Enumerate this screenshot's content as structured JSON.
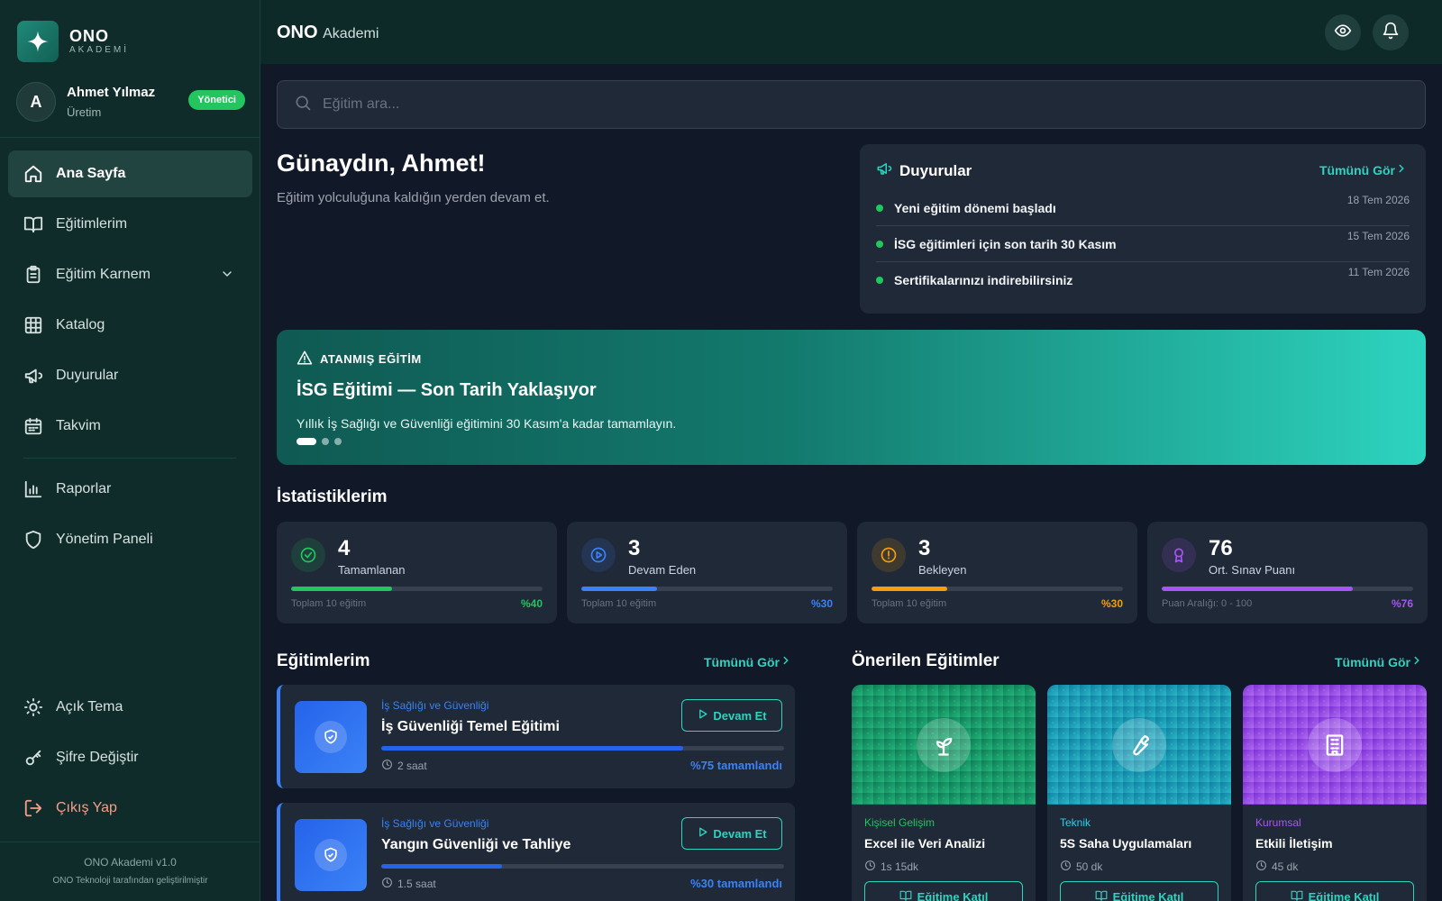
{
  "app": {
    "name": "ONO",
    "sub": "AKADEMİ",
    "top_title_bold": "ONO",
    "top_title_rest": "Akademi"
  },
  "user": {
    "initial": "A",
    "name": "Ahmet Yılmaz",
    "department": "Üretim",
    "role_badge": "Yönetici"
  },
  "nav": {
    "home": "Ana Sayfa",
    "my_trainings": "Eğitimlerim",
    "report_card": "Eğitim Karnem",
    "catalog": "Katalog",
    "announcements": "Duyurular",
    "calendar": "Takvim",
    "reports": "Raporlar",
    "admin_panel": "Yönetim Paneli",
    "light_theme": "Açık Tema",
    "change_password": "Şifre Değiştir",
    "logout": "Çıkış Yap"
  },
  "footer": {
    "version": "ONO Akademi v1.0",
    "credit": "ONO Teknoloji tarafından geliştirilmiştir"
  },
  "search": {
    "placeholder": "Eğitim ara..."
  },
  "greeting": {
    "title": "Günaydın, Ahmet!",
    "subtitle": "Eğitim yolculuğuna kaldığın yerden devam et."
  },
  "announcements": {
    "title": "Duyurular",
    "see_all": "Tümünü Gör",
    "items": [
      {
        "text": "Yeni eğitim dönemi başladı",
        "date": "18 Tem 2026"
      },
      {
        "text": "İSG eğitimleri için son tarih 30 Kasım",
        "date": "15 Tem 2026"
      },
      {
        "text": "Sertifikalarınızı indirebilirsiniz",
        "date": "11 Tem 2026"
      }
    ]
  },
  "banner": {
    "tag": "ATANMIŞ EĞİTİM",
    "title": "İSG Eğitimi — Son Tarih Yaklaşıyor",
    "text": "Yıllık İş Sağlığı ve Güvenliği eğitimini 30 Kasım'a kadar tamamlayın.",
    "active_slide": 1,
    "slide_count": 3
  },
  "stats": {
    "title": "İstatistiklerim",
    "items": [
      {
        "value": "4",
        "label": "Tamamlanan",
        "foot": "Toplam 10 eğitim",
        "pct_label": "%40",
        "fraction": 0.4,
        "color": "#22c55e",
        "icon": "check-circle-icon"
      },
      {
        "value": "3",
        "label": "Devam Eden",
        "foot": "Toplam 10 eğitim",
        "pct_label": "%30",
        "fraction": 0.3,
        "color": "#3b82f6",
        "icon": "play-circle-icon"
      },
      {
        "value": "3",
        "label": "Bekleyen",
        "foot": "Toplam 10 eğitim",
        "pct_label": "%30",
        "fraction": 0.3,
        "color": "#f59e0b",
        "icon": "alert-circle-icon"
      },
      {
        "value": "76",
        "label": "Ort. Sınav Puanı",
        "foot": "Puan Aralığı: 0 - 100",
        "pct_label": "%76",
        "fraction": 0.76,
        "color": "#a855f7",
        "icon": "award-icon"
      }
    ]
  },
  "my_courses": {
    "title": "Eğitimlerim",
    "see_all": "Tümünü Gör",
    "items": [
      {
        "category": "İş Sağlığı ve Güvenliği",
        "title": "İş Güvenliği Temel Eğitimi",
        "duration": "2 saat",
        "progress_label": "%75 tamamlandı",
        "fraction": 0.75,
        "button": "Devam Et"
      },
      {
        "category": "İş Sağlığı ve Güvenliği",
        "title": "Yangın Güvenliği ve Tahliye",
        "duration": "1.5 saat",
        "progress_label": "%30 tamamlandı",
        "fraction": 0.3,
        "button": "Devam Et"
      }
    ]
  },
  "recommended": {
    "title": "Önerilen Eğitimler",
    "see_all": "Tümünü Gör",
    "items": [
      {
        "category": "Kişisel Gelişim",
        "title": "Excel ile Veri Analizi",
        "duration": "1s 15dk",
        "button": "Eğitime Katıl",
        "color": "#22c55e",
        "icon": "sprout-icon"
      },
      {
        "category": "Teknik",
        "title": "5S Saha Uygulamaları",
        "duration": "50 dk",
        "button": "Eğitime Katıl",
        "color": "#22d3ee",
        "icon": "wrench-icon"
      },
      {
        "category": "Kurumsal",
        "title": "Etkili İletişim",
        "duration": "45 dk",
        "button": "Eğitime Katıl",
        "color": "#a855f7",
        "icon": "building-icon"
      }
    ]
  }
}
